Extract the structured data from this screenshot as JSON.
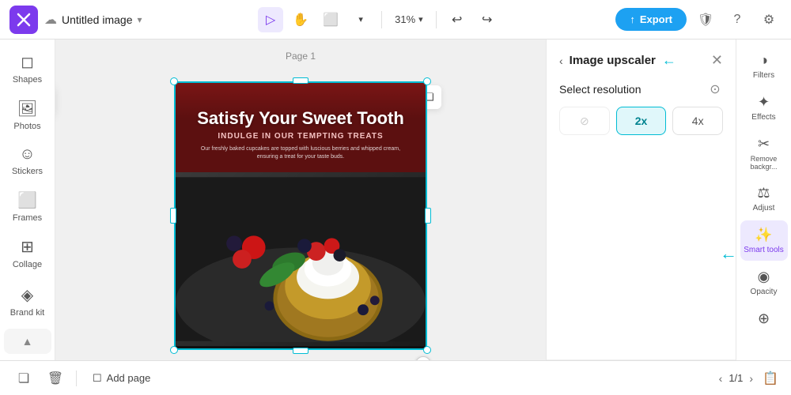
{
  "app": {
    "logo_symbol": "✕",
    "title": "Untitled image",
    "title_chevron": "▾",
    "export_label": "Export",
    "zoom_value": "31%",
    "zoom_chevron": "▾"
  },
  "topbar_tools": [
    {
      "name": "select-tool",
      "icon": "▷",
      "active": true
    },
    {
      "name": "hand-tool",
      "icon": "✋",
      "active": false
    },
    {
      "name": "frame-tool",
      "icon": "⬜",
      "active": false
    },
    {
      "name": "frame-dropdown",
      "icon": "▾",
      "active": false
    }
  ],
  "canvas": {
    "page_label": "Page 1",
    "image_headline": "Satisfy Your Sweet Tooth",
    "image_sub": "INDULGE IN OUR TEMPTING TREATS",
    "image_body": "Our freshly baked cupcakes are topped with luscious berries and whipped cream, ensuring a treat for your taste buds."
  },
  "upscaler": {
    "title": "Image upscaler",
    "resolution_label": "Select resolution",
    "back_icon": "‹",
    "close_icon": "✕",
    "options": [
      {
        "label": "⊘",
        "value": "off",
        "active": false,
        "disabled": true
      },
      {
        "label": "2x",
        "value": "2x",
        "active": true,
        "disabled": false
      },
      {
        "label": "4x",
        "value": "4x",
        "active": false,
        "disabled": false
      }
    ]
  },
  "right_tools": [
    {
      "name": "filters",
      "icon": "◑",
      "label": "Filters",
      "active": false
    },
    {
      "name": "effects",
      "icon": "✦",
      "label": "Effects",
      "active": false
    },
    {
      "name": "remove-bg",
      "icon": "✂",
      "label": "Remove backgr...",
      "active": false
    },
    {
      "name": "adjust",
      "icon": "⚖",
      "label": "Adjust",
      "active": false
    },
    {
      "name": "smart-tools",
      "icon": "✨",
      "label": "Smart tools",
      "active": true
    },
    {
      "name": "opacity",
      "icon": "◉",
      "label": "Opacity",
      "active": false
    },
    {
      "name": "more-effects",
      "icon": "⊕",
      "label": "",
      "active": false
    }
  ],
  "left_sidebar": [
    {
      "name": "shapes",
      "icon": "◻",
      "label": "Shapes"
    },
    {
      "name": "photos",
      "icon": "🖼",
      "label": "Photos"
    },
    {
      "name": "stickers",
      "icon": "☺",
      "label": "Stickers"
    },
    {
      "name": "frames",
      "icon": "⬜",
      "label": "Frames"
    },
    {
      "name": "collage",
      "icon": "⊞",
      "label": "Collage"
    },
    {
      "name": "brand-kit",
      "icon": "◈",
      "label": "Brand kit"
    }
  ],
  "bottombar": {
    "add_page_label": "Add page",
    "page_current": "1",
    "page_total": "1"
  }
}
